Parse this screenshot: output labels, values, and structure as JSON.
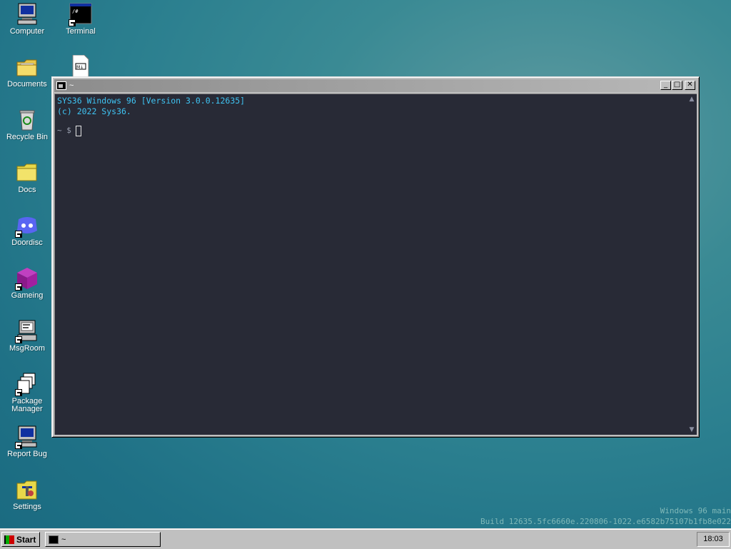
{
  "desktop_icons": [
    {
      "label": "Computer",
      "icon": "computer-icon"
    },
    {
      "label": "Terminal",
      "icon": "terminal-icon"
    },
    {
      "label": "Documents",
      "icon": "documents-folder-icon"
    },
    {
      "label": "Recycle Bin",
      "icon": "recycle-bin-icon"
    },
    {
      "label": "Docs",
      "icon": "folder-icon"
    },
    {
      "label": "Doordisc",
      "icon": "doordisc-icon"
    },
    {
      "label": "Gameing",
      "icon": "cube-icon"
    },
    {
      "label": "MsgRoom",
      "icon": "msgroom-icon"
    },
    {
      "label": "Package Manager",
      "icon": "package-icon"
    },
    {
      "label": "Report Bug",
      "icon": "monitor-icon"
    },
    {
      "label": "Settings",
      "icon": "settings-icon"
    }
  ],
  "window": {
    "title": "~",
    "buttons": {
      "minimize": "_",
      "maximize": "□",
      "close": "✕"
    },
    "terminal": {
      "line1": "SYS36 Windows 96 [Version 3.0.0.12635]",
      "line2": "(c) 2022 Sys36.",
      "prompt": "~ $"
    }
  },
  "build_info": {
    "line1": "Windows 96 main",
    "line2": "Build 12635.5fc6660e.220806-1022.e6582b75107b1fb8e022"
  },
  "taskbar": {
    "start_label": "Start",
    "task_label": "~",
    "clock": "18:03"
  }
}
